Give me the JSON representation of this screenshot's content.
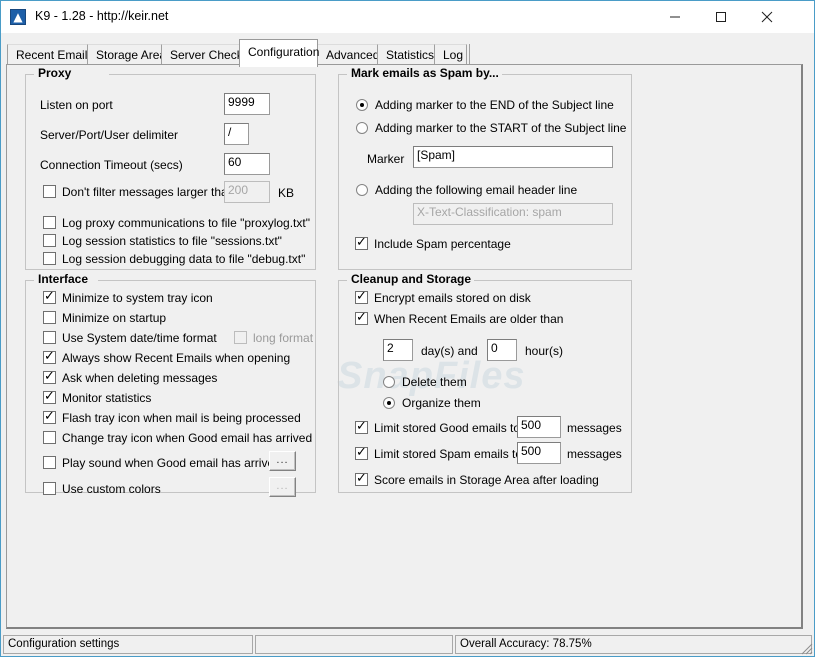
{
  "window": {
    "title": "K9 - 1.28 - http://keir.net",
    "icon": "app-icon",
    "minimize_label": "Minimize",
    "maximize_label": "Maximize",
    "close_label": "Close"
  },
  "tabs": [
    {
      "label": "Recent Emails",
      "selected": false
    },
    {
      "label": "Storage Area",
      "selected": false
    },
    {
      "label": "Server Check",
      "selected": false
    },
    {
      "label": "Configuration",
      "selected": true
    },
    {
      "label": "Advanced",
      "selected": false
    },
    {
      "label": "Statistics",
      "selected": false
    },
    {
      "label": "Log",
      "selected": false
    }
  ],
  "proxy": {
    "title": "Proxy",
    "listen_port_label": "Listen on port",
    "listen_port_value": "9999",
    "delimiter_label": "Server/Port/User delimiter",
    "delimiter_value": "/",
    "timeout_label": "Connection Timeout (secs)",
    "timeout_value": "60",
    "dont_filter_label": "Don't filter messages larger than",
    "dont_filter_checked": false,
    "dont_filter_value": "200",
    "dont_filter_unit": "KB",
    "log_proxy_label": "Log proxy communications to file \"proxylog.txt\"",
    "log_proxy_checked": false,
    "log_stats_label": "Log session statistics to file \"sessions.txt\"",
    "log_stats_checked": false,
    "log_debug_label": "Log session debugging data to file \"debug.txt\"",
    "log_debug_checked": false
  },
  "interface": {
    "title": "Interface",
    "items": [
      {
        "label": "Minimize to system tray icon",
        "checked": true
      },
      {
        "label": "Minimize on startup",
        "checked": false
      },
      {
        "label": "Use System date/time format",
        "checked": false
      },
      {
        "label": "Always show Recent Emails when opening",
        "checked": true
      },
      {
        "label": "Ask when deleting messages",
        "checked": true
      },
      {
        "label": "Monitor statistics",
        "checked": true
      },
      {
        "label": "Flash tray icon when mail is being processed",
        "checked": true
      },
      {
        "label": "Change tray icon when Good email has arrived",
        "checked": false
      },
      {
        "label": "Play sound when Good email has arrived",
        "checked": false
      },
      {
        "label": "Use custom colors",
        "checked": false
      }
    ],
    "long_format_label": "long format",
    "long_format_checked": false,
    "long_format_disabled": true,
    "sound_browse_label": "...",
    "colors_browse_label": "..."
  },
  "spam": {
    "title": "Mark emails as Spam by...",
    "option_end_label": "Adding marker to the END of the Subject line",
    "option_start_label": "Adding marker to the START of the Subject line",
    "option_header_label": "Adding the following email header line",
    "selected_option": "end",
    "marker_label": "Marker",
    "marker_value": "[Spam]",
    "header_value": "X-Text-Classification: spam",
    "header_disabled": true,
    "include_percentage_label": "Include Spam percentage",
    "include_percentage_checked": true
  },
  "cleanup": {
    "title": "Cleanup and Storage",
    "encrypt_label": "Encrypt emails stored on disk",
    "encrypt_checked": true,
    "older_than_label": "When Recent Emails are older than",
    "older_than_checked": true,
    "days_value": "2",
    "days_unit": "day(s) and",
    "hours_value": "0",
    "hours_unit": "hour(s)",
    "delete_label": "Delete them",
    "organize_label": "Organize them",
    "selected_action": "organize",
    "limit_good_label": "Limit stored Good emails to",
    "limit_good_checked": true,
    "limit_good_value": "500",
    "limit_good_unit": "messages",
    "limit_spam_label": "Limit stored Spam emails to",
    "limit_spam_checked": true,
    "limit_spam_value": "500",
    "limit_spam_unit": "messages",
    "score_label": "Score emails in Storage Area after loading",
    "score_checked": true
  },
  "statusbar": {
    "left": "Configuration settings",
    "middle": "",
    "right": "Overall Accuracy: 78.75%"
  },
  "watermark": "SnapFiles",
  "colors": {
    "window_border": "#4a9cc7",
    "face": "#f0f0f0",
    "groupbox_border": "#c4c4c4",
    "field_border": "#7d7d7d",
    "disabled_text": "#a6a6a6",
    "icon_blue": "#1d5fa8"
  }
}
